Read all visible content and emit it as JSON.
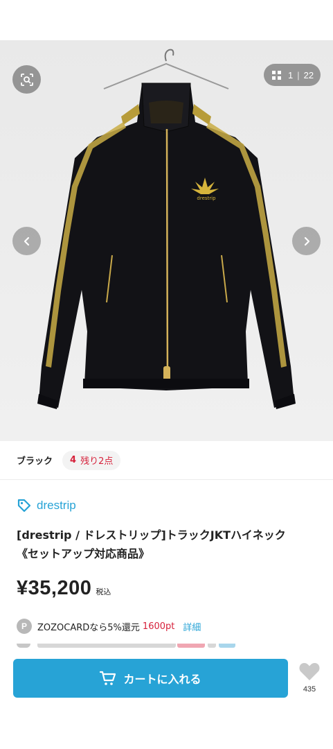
{
  "gallery": {
    "counter_current": "1",
    "counter_separator": "|",
    "counter_total": "22",
    "product_logo_text": "drestrip"
  },
  "color": {
    "name": "ブラック",
    "stock_count": "4",
    "stock_text": "残り2点"
  },
  "brand": {
    "name": "drestrip",
    "color": "#27a3d6"
  },
  "product": {
    "title_line1": "[drestrip / ドレストリップ]トラックJKTハイネック",
    "title_line2": "《セットアップ対応商品》",
    "price": "¥35,200",
    "tax_label": "税込"
  },
  "points": {
    "icon": "P",
    "text": "ZOZOCARDなら5%還元",
    "points": "1600pt",
    "detail_link": "詳細"
  },
  "actions": {
    "cart_label": "カートに入れる",
    "favorite_count": "435"
  },
  "colors": {
    "accent": "#27a3d6",
    "alert": "#d6213b"
  }
}
